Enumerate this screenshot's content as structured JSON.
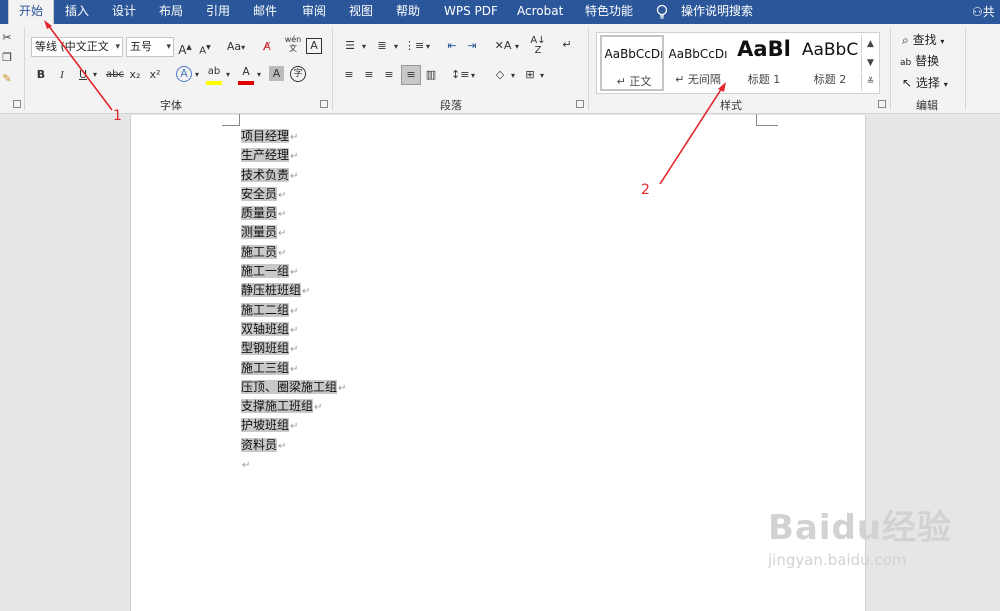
{
  "tabs": [
    {
      "label": "开始",
      "active": true
    },
    {
      "label": "插入"
    },
    {
      "label": "设计"
    },
    {
      "label": "布局"
    },
    {
      "label": "引用"
    },
    {
      "label": "邮件"
    },
    {
      "label": "审阅"
    },
    {
      "label": "视图"
    },
    {
      "label": "帮助"
    },
    {
      "label": "WPS PDF"
    },
    {
      "label": "Acrobat"
    },
    {
      "label": "特色功能"
    }
  ],
  "tell_me": "操作说明搜索",
  "share": "共",
  "font_group": {
    "label": "字体",
    "font_name": "等线 (中文正文",
    "font_size": "五号",
    "grow": "A",
    "shrink": "A",
    "case": "Aa",
    "bold": "B",
    "italic": "I",
    "underline": "U",
    "strike": "abc",
    "subscript": "x₂",
    "superscript": "x²",
    "phonetic": "wén",
    "enclose": "字"
  },
  "paragraph_group": {
    "label": "段落"
  },
  "styles_group": {
    "label": "样式",
    "items": [
      {
        "sample": "AaBbCcDı",
        "name": "↵ 正文"
      },
      {
        "sample": "AaBbCcDı",
        "name": "↵ 无间隔"
      },
      {
        "sample": "AaBl",
        "name": "标题 1"
      },
      {
        "sample": "AaBbC",
        "name": "标题 2"
      }
    ]
  },
  "editing_group": {
    "label": "编辑",
    "find": "查找",
    "replace": "替换",
    "select": "选择"
  },
  "document": {
    "lines": [
      "项目经理",
      "生产经理",
      "技术负责",
      "安全员",
      "质量员",
      "测量员",
      "施工员",
      "施工一组",
      "静压桩班组",
      "施工二组",
      "双轴班组",
      "型钢班组",
      "施工三组",
      "压顶、圈梁施工组",
      "支撑施工班组",
      "护坡班组",
      "资料员"
    ],
    "paragraph_mark": "↵"
  },
  "annotations": {
    "first": "1",
    "second": "2"
  },
  "watermark": {
    "brand": "Baidu经验",
    "url": "jingyan.baidu.com"
  },
  "colors": {
    "accent": "#2b579a",
    "annotation": "#e3262b",
    "highlight": "#ffff00",
    "font_color": "#e00000"
  }
}
